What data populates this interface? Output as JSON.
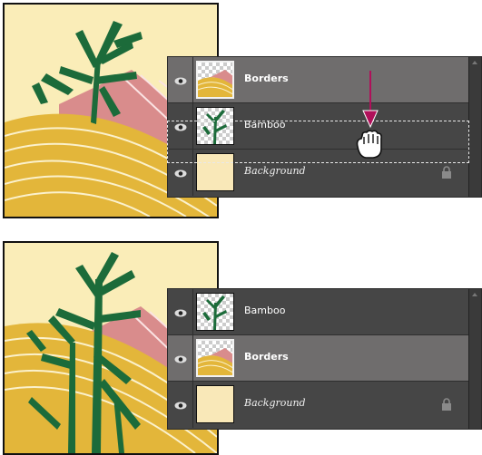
{
  "scene_top": {
    "layers": [
      {
        "name": "Borders",
        "style": "bold",
        "thumb": "borders",
        "selected": true
      },
      {
        "name": "Bamboo",
        "style": "normal",
        "thumb": "bamboo",
        "selected": false
      },
      {
        "name": "Background",
        "style": "italic",
        "thumb": "background",
        "selected": false,
        "locked": true
      }
    ]
  },
  "scene_bottom": {
    "layers": [
      {
        "name": "Bamboo",
        "style": "normal",
        "thumb": "bamboo",
        "selected": false
      },
      {
        "name": "Borders",
        "style": "bold",
        "thumb": "borders",
        "selected": true
      },
      {
        "name": "Background",
        "style": "italic",
        "thumb": "background",
        "selected": false,
        "locked": true
      }
    ]
  },
  "colors": {
    "panel_bg": "#464646",
    "selected_row": "#6f6d6d",
    "drag_arrow": "#b0105a",
    "artwork_cream": "#faedb8",
    "artwork_gold": "#e3b63a",
    "artwork_pink": "#d98c8c",
    "bamboo_green": "#1c6b3a"
  },
  "icons": [
    "eye-icon",
    "lock-icon",
    "grab-hand-icon",
    "arrow-down-icon",
    "scroll-up-arrow-icon"
  ]
}
